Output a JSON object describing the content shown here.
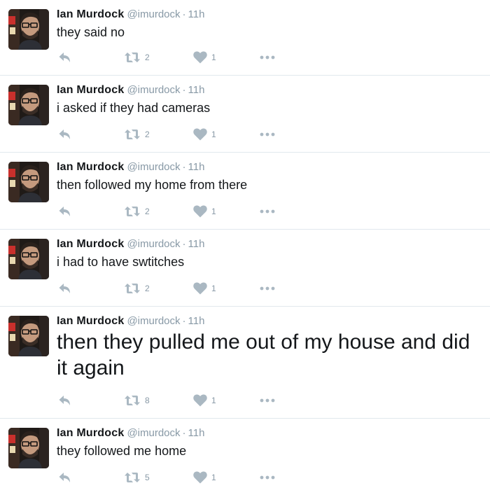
{
  "colors": {
    "icon_gray": "#aab8c2",
    "text_gray": "#8899a6",
    "divider": "#e1e8ed",
    "text_dark": "#14171a"
  },
  "tweets": [
    {
      "name": "Ian Murdock",
      "handle": "@imurdock",
      "separator": "·",
      "time": "11h",
      "text": "they said no",
      "retweets": "2",
      "likes": "1"
    },
    {
      "name": "Ian Murdock",
      "handle": "@imurdock",
      "separator": "·",
      "time": "11h",
      "text": "i asked if they had cameras",
      "retweets": "2",
      "likes": "1"
    },
    {
      "name": "Ian Murdock",
      "handle": "@imurdock",
      "separator": "·",
      "time": "11h",
      "text": "then followed my home from there",
      "retweets": "2",
      "likes": "1"
    },
    {
      "name": "Ian Murdock",
      "handle": "@imurdock",
      "separator": "·",
      "time": "11h",
      "text": "i had to have swtitches",
      "retweets": "2",
      "likes": "1"
    },
    {
      "name": "Ian Murdock",
      "handle": "@imurdock",
      "separator": "·",
      "time": "11h",
      "text": "then they pulled me out of my house and did it again",
      "retweets": "8",
      "likes": "1"
    },
    {
      "name": "Ian Murdock",
      "handle": "@imurdock",
      "separator": "·",
      "time": "11h",
      "text": "they followed me home",
      "retweets": "5",
      "likes": "1"
    }
  ],
  "icons": {
    "reply": "reply-arrow-icon",
    "retweet": "retweet-icon",
    "like": "heart-icon",
    "more": "more-dots-icon",
    "avatar": "profile-photo"
  }
}
